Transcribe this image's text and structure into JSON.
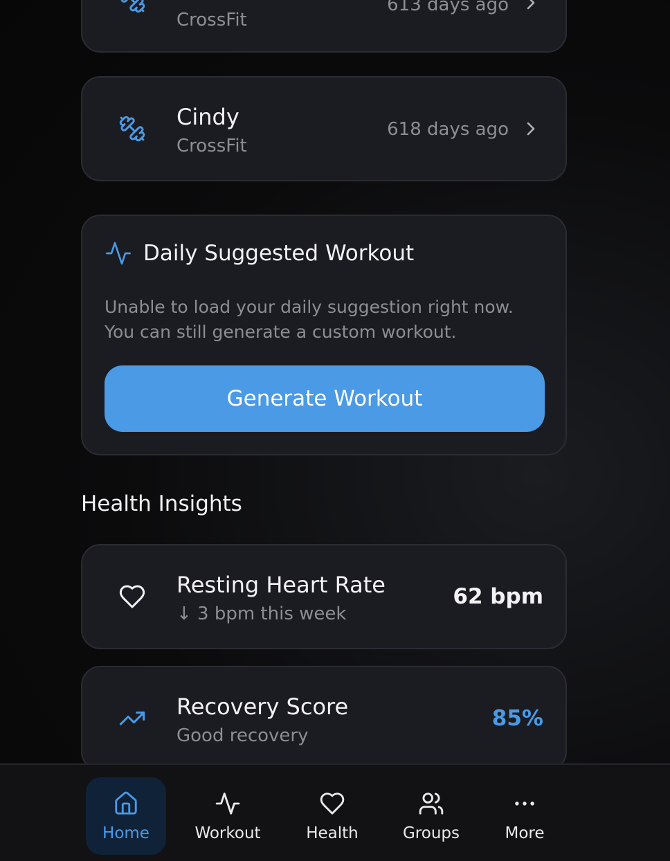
{
  "recent_workouts": [
    {
      "name": "",
      "type": "CrossFit",
      "ago": "613 days ago"
    },
    {
      "name": "Cindy",
      "type": "CrossFit",
      "ago": "618 days ago"
    }
  ],
  "suggestion": {
    "title": "Daily Suggested Workout",
    "body": "Unable to load your daily suggestion right now. You can still generate a custom workout.",
    "button_label": "Generate Workout"
  },
  "health_insights": {
    "title": "Health Insights",
    "items": [
      {
        "title": "Resting Heart Rate",
        "sub": "↓ 3 bpm this week",
        "value": "62 bpm",
        "value_color": "#f2f2f4",
        "icon": "heart-icon"
      },
      {
        "title": "Recovery Score",
        "sub": "Good recovery",
        "value": "85%",
        "value_color": "#4a9ae6",
        "icon": "trending-up-icon"
      }
    ]
  },
  "tabbar": {
    "active": "Home",
    "tabs": [
      {
        "label": "Home",
        "icon": "home-icon"
      },
      {
        "label": "Workout",
        "icon": "activity-icon"
      },
      {
        "label": "Health",
        "icon": "heart-icon"
      },
      {
        "label": "Groups",
        "icon": "users-icon"
      },
      {
        "label": "More",
        "icon": "more-icon"
      }
    ]
  },
  "colors": {
    "accent": "#4a9ae6",
    "card": "#1b1c21",
    "muted": "#8c8e94"
  }
}
